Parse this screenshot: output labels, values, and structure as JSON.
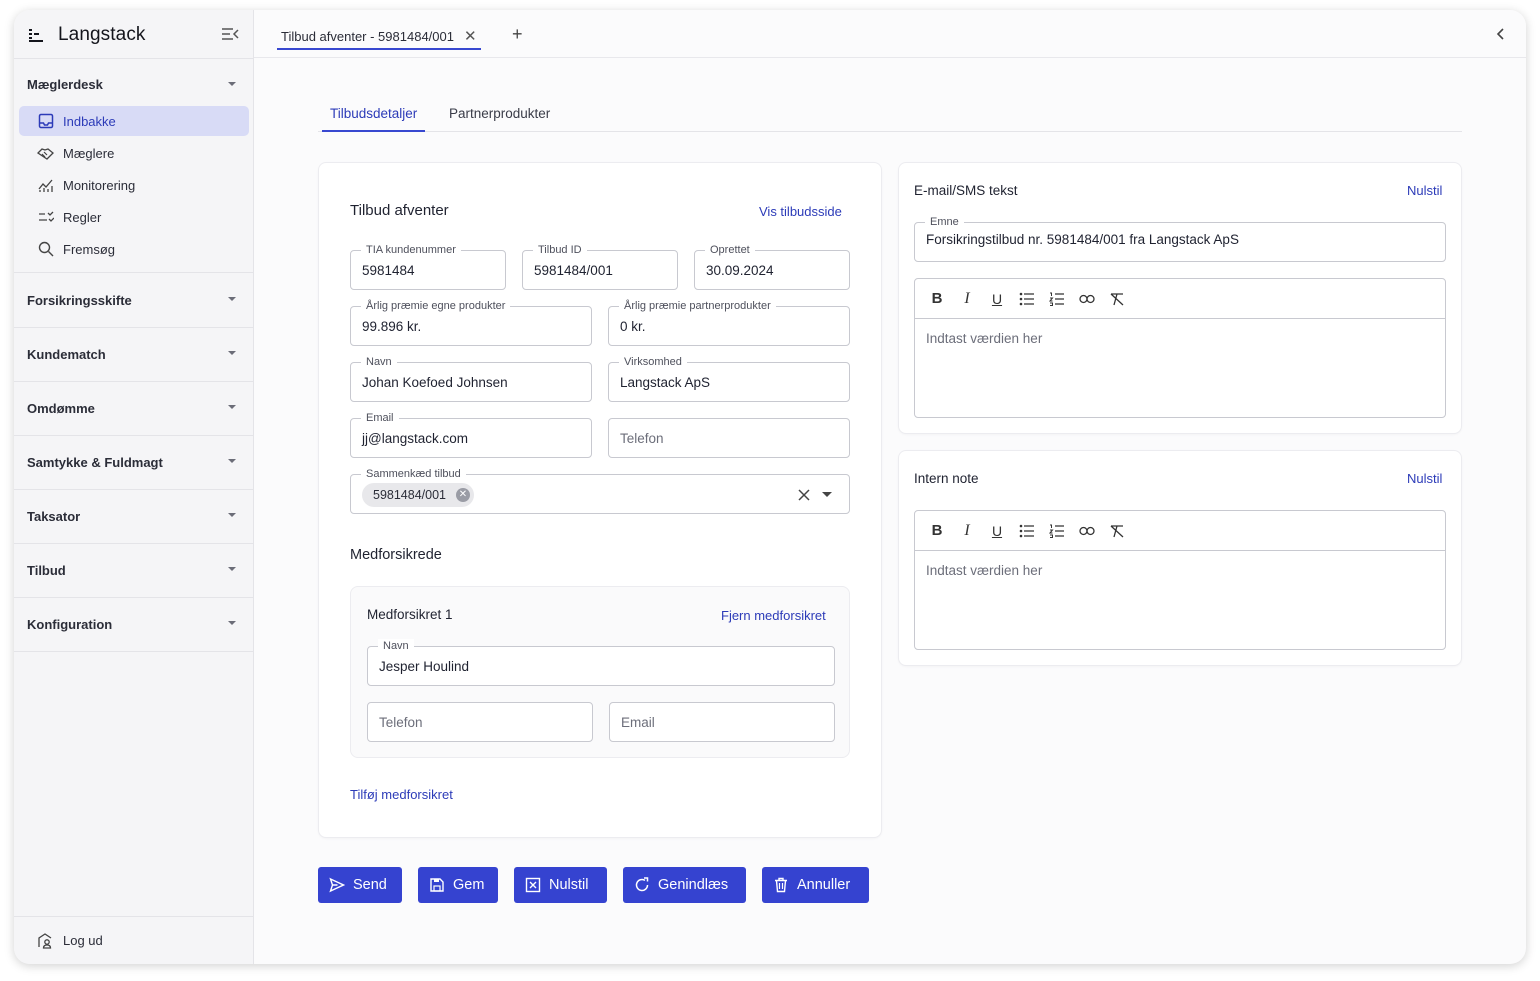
{
  "app": {
    "name": "Langstack"
  },
  "sidebar": {
    "sections": [
      {
        "label": "Mæglerdesk",
        "items": [
          {
            "label": "Indbakke",
            "icon": "inbox-icon",
            "active": true
          },
          {
            "label": "Mæglere",
            "icon": "handshake-icon"
          },
          {
            "label": "Monitorering",
            "icon": "chart-icon"
          },
          {
            "label": "Regler",
            "icon": "rules-icon"
          },
          {
            "label": "Fremsøg",
            "icon": "search-icon"
          }
        ]
      },
      {
        "label": "Forsikringsskifte"
      },
      {
        "label": "Kundematch"
      },
      {
        "label": "Omdømme"
      },
      {
        "label": "Samtykke & Fuldmagt"
      },
      {
        "label": "Taksator"
      },
      {
        "label": "Tilbud"
      },
      {
        "label": "Konfiguration"
      }
    ],
    "logout_label": "Log ud"
  },
  "tabbar": {
    "open_tab": "Tilbud afventer - 5981484/001",
    "close_glyph": "✕",
    "add_glyph": "+"
  },
  "content_tabs": [
    {
      "label": "Tilbudsdetaljer",
      "active": true
    },
    {
      "label": "Partnerprodukter"
    }
  ],
  "offer": {
    "title": "Tilbud afventer",
    "link": "Vis tilbudsside",
    "fields": {
      "tia": {
        "label": "TIA kundenummer",
        "value": "5981484"
      },
      "tilbud_id": {
        "label": "Tilbud ID",
        "value": "5981484/001"
      },
      "oprettet": {
        "label": "Oprettet",
        "value": "30.09.2024"
      },
      "praemie_egne": {
        "label": "Årlig præmie egne produkter",
        "value": "99.896 kr."
      },
      "praemie_partner": {
        "label": "Årlig præmie partnerprodukter",
        "value": "0 kr."
      },
      "navn": {
        "label": "Navn",
        "value": "Johan Koefoed Johnsen"
      },
      "virksomhed": {
        "label": "Virksomhed",
        "value": "Langstack ApS"
      },
      "email": {
        "label": "Email",
        "value": "jj@langstack.com"
      },
      "telefon": {
        "placeholder": "Telefon"
      },
      "sammenkaed": {
        "label": "Sammenkæd tilbud",
        "chip": "5981484/001"
      }
    }
  },
  "medforsikrede": {
    "title": "Medforsikrede",
    "item_title": "Medforsikret 1",
    "remove_link": "Fjern medforsikret",
    "navn": {
      "label": "Navn",
      "value": "Jesper Houlind"
    },
    "telefon_placeholder": "Telefon",
    "email_placeholder": "Email",
    "add_link": "Tilføj medforsikret"
  },
  "email_sms": {
    "title": "E-mail/SMS tekst",
    "reset": "Nulstil",
    "subject": {
      "label": "Emne",
      "value": "Forsikringstilbud nr. 5981484/001 fra Langstack ApS"
    },
    "placeholder": "Indtast værdien her"
  },
  "intern_note": {
    "title": "Intern note",
    "reset": "Nulstil",
    "placeholder": "Indtast værdien her"
  },
  "buttons": {
    "send": "Send",
    "gem": "Gem",
    "nulstil": "Nulstil",
    "genindlaes": "Genindlæs",
    "annuller": "Annuller"
  },
  "colors": {
    "accent": "#3543d0",
    "active_bg": "#d8dbf6",
    "link": "#2c3bb8"
  }
}
